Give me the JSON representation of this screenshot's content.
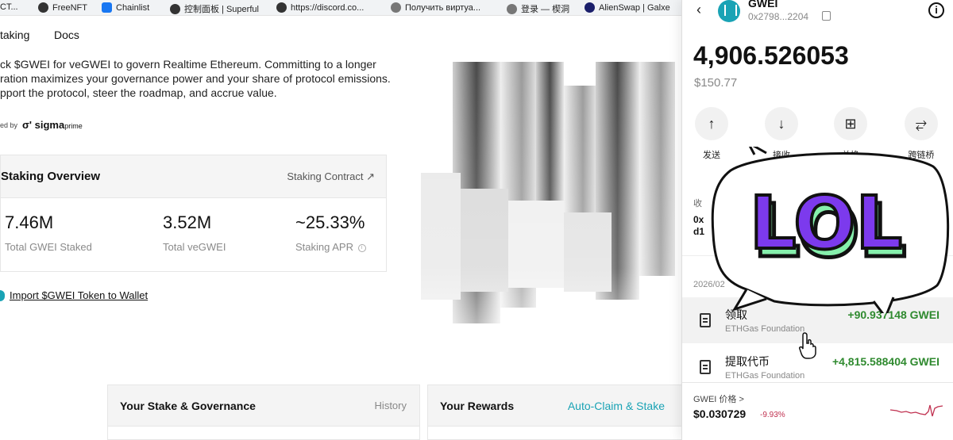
{
  "bookmarks": [
    {
      "label": "CT..."
    },
    {
      "label": "FreeNFT"
    },
    {
      "label": "Chainlist"
    },
    {
      "label": "控制面板 | Superful"
    },
    {
      "label": "https://discord.co..."
    },
    {
      "label": "Получить виртуа..."
    },
    {
      "label": "登录 — 楔洞"
    },
    {
      "label": "AlienSwap | Galxe"
    }
  ],
  "nav": {
    "staking": "taking",
    "docs": "Docs"
  },
  "intro": {
    "line1": "ck $GWEI for veGWEI to govern Realtime Ethereum. Committing to a longer",
    "line2": "ration maximizes your governance power and your share of protocol emissions.",
    "line3": "pport the protocol, steer the roadmap, and accrue value."
  },
  "powered": {
    "prefix": "ed by",
    "brand": "sigma",
    "brand_suffix": "prime"
  },
  "overview": {
    "title": "Staking Overview",
    "contract_link": "Staking Contract ↗",
    "stats": [
      {
        "value": "7.46M",
        "label": "Total GWEI Staked"
      },
      {
        "value": "3.52M",
        "label": "Total veGWEI"
      },
      {
        "value": "~25.33%",
        "label": "Staking APR"
      }
    ]
  },
  "import_link": "Import $GWEI Token to Wallet",
  "cards": {
    "stake": {
      "title": "Your Stake & Governance",
      "action": "History"
    },
    "rewards": {
      "title": "Your Rewards",
      "action": "Auto-Claim & Stake"
    }
  },
  "wallet": {
    "token": "GWEI",
    "address": "0x2798...2204",
    "balance": "4,906.526053",
    "usd": "$150.77",
    "actions": [
      {
        "label": "发送",
        "icon": "arrow-up-icon",
        "glyph": "↑"
      },
      {
        "label": "接收",
        "icon": "arrow-down-icon",
        "glyph": "↓"
      },
      {
        "label": "兑换",
        "icon": "swap-icon",
        "glyph": "⊞"
      },
      {
        "label": "跨链桥",
        "icon": "bridge-icon",
        "glyph": "⥂"
      }
    ],
    "receive_label": "收",
    "receive_addr_1": "0x",
    "receive_addr_2": "d1",
    "date": "2026/02",
    "transactions": [
      {
        "name": "领取",
        "sub": "ETHGas Foundation",
        "amount": "+90.937148 GWEI"
      },
      {
        "name": "提取代币",
        "sub": "ETHGas Foundation",
        "amount": "+4,815.588404 GWEI"
      }
    ],
    "price_label": "GWEI 价格 >",
    "price": "$0.030729",
    "change": "-9.93%"
  },
  "sticker_text": "LOL",
  "colors": {
    "accent": "#1aa3b5",
    "positive": "#2f8a2f",
    "negative": "#c0304f",
    "sticker_fill": "#7c3aed",
    "sticker_edge": "#86efac"
  }
}
